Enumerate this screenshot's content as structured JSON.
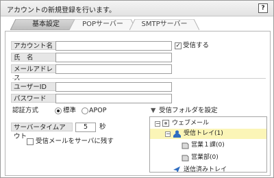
{
  "dialog": {
    "title": "アカウントの新規登録を行います。",
    "help_label": "?"
  },
  "tabs": [
    {
      "label": "基本設定",
      "active": true
    },
    {
      "label": "POPサーバー",
      "active": false
    },
    {
      "label": "SMTPサーバー",
      "active": false
    }
  ],
  "form": {
    "account_name_label": "アカウント名",
    "name_label": "氏　名",
    "email_label": "メールアドレス",
    "user_id_label": "ユーザーID",
    "password_label": "パスワード",
    "receive_label": "受信する",
    "receive_checked": true,
    "auth_label": "認証方式",
    "auth_options": [
      "標準",
      "APOP"
    ],
    "auth_selected": "標準",
    "timeout_label": "サーバータイムアウト",
    "timeout_value": "5",
    "timeout_unit": "秒",
    "keep_on_server_label": "受信メールをサーバに残す",
    "keep_on_server_checked": false
  },
  "folder_tree": {
    "header": "受信フォルダを設定",
    "items": [
      {
        "label": "ウェブメール",
        "toggle": "⊟",
        "icon": "globe-icon"
      },
      {
        "label": "受信トレイ(1)",
        "toggle": "⊟",
        "icon": "inbox-icon",
        "selected": true
      },
      {
        "label": "営業１課(0)",
        "icon": "folder-icon"
      },
      {
        "label": "営業部(0)",
        "icon": "folder-icon"
      },
      {
        "label": "送信済みトレイ",
        "icon": "sent-icon"
      }
    ]
  },
  "colors": {
    "selected_row": "#fbf5b7",
    "label_bg": "#e6e6e6",
    "border": "#9c9c9c",
    "accent_blue": "#2f6dc1"
  }
}
